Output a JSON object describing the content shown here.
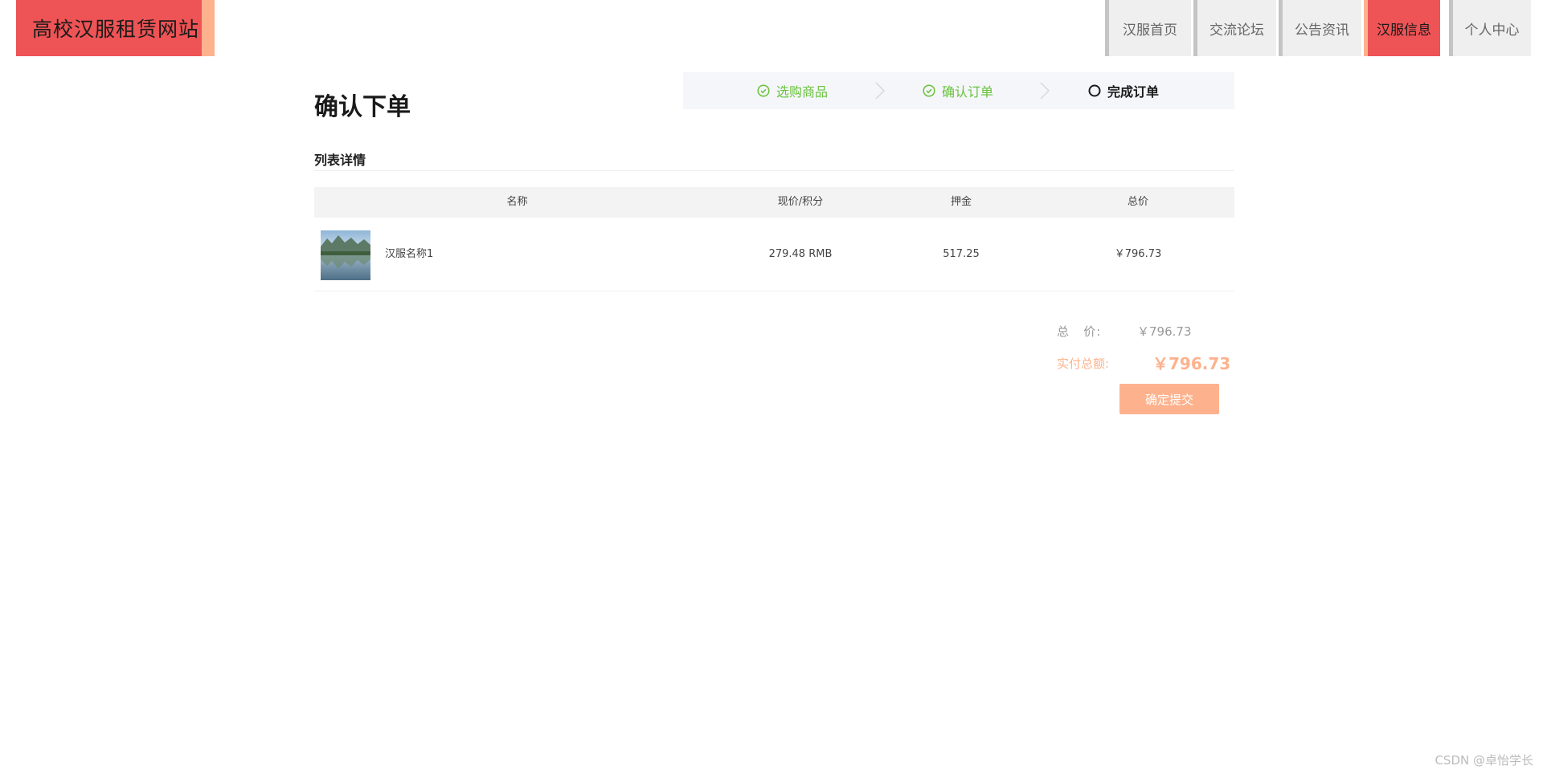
{
  "site": {
    "title": "高校汉服租赁网站"
  },
  "nav": {
    "items": [
      {
        "label": "汉服首页",
        "active": false
      },
      {
        "label": "交流论坛",
        "active": false
      },
      {
        "label": "公告资讯",
        "active": false
      },
      {
        "label": "汉服信息",
        "active": true
      },
      {
        "label": "个人中心",
        "active": false
      }
    ]
  },
  "page": {
    "title": "确认下单"
  },
  "steps": [
    {
      "label": "选购商品",
      "status": "done",
      "icon": "check-circle-icon"
    },
    {
      "label": "确认订单",
      "status": "done",
      "icon": "check-circle-icon"
    },
    {
      "label": "完成订单",
      "status": "current",
      "icon": "circle-icon"
    }
  ],
  "list": {
    "title": "列表详情",
    "columns": [
      "名称",
      "现价/积分",
      "押金",
      "总价"
    ],
    "rows": [
      {
        "name": "汉服名称1",
        "price": "279.48 RMB",
        "deposit": "517.25",
        "total": "￥796.73",
        "thumbnail": "landscape-image"
      }
    ]
  },
  "summary": {
    "total_label": "总   价:",
    "total_value": "￥796.73",
    "pay_label": "实付总额:",
    "pay_value": "￥796.73",
    "submit_label": "确定提交"
  },
  "watermark": "CSDN @卓怡学长",
  "colors": {
    "primary_red": "#ee5355",
    "accent_peach": "#fdb28d",
    "success_green": "#67c23a"
  }
}
